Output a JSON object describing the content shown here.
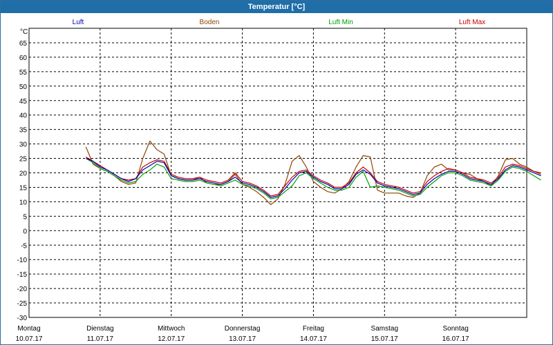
{
  "window": {
    "title": "Temperatur [°C]"
  },
  "chart_data": {
    "type": "line",
    "title": "Temperatur [°C]",
    "ylabel": "°C",
    "xlabel": "",
    "ylim": [
      -30,
      70
    ],
    "yticks": [
      65,
      60,
      55,
      50,
      45,
      40,
      35,
      30,
      25,
      20,
      15,
      10,
      5,
      0,
      -5,
      -10,
      -15,
      -20,
      -25,
      -30
    ],
    "grid": true,
    "legend_position": "top",
    "x_labels": [
      {
        "day": "Montag",
        "date": "10.07.17"
      },
      {
        "day": "Dienstag",
        "date": "11.07.17"
      },
      {
        "day": "Mittwoch",
        "date": "12.07.17"
      },
      {
        "day": "Donnerstag",
        "date": "13.07.17"
      },
      {
        "day": "Freitag",
        "date": "14.07.17"
      },
      {
        "day": "Samstag",
        "date": "15.07.17"
      },
      {
        "day": "Sonntag",
        "date": "16.07.17"
      }
    ],
    "x": [
      0.8,
      0.9,
      1,
      1.1,
      1.2,
      1.3,
      1.4,
      1.5,
      1.6,
      1.7,
      1.8,
      1.9,
      2,
      2.1,
      2.2,
      2.3,
      2.4,
      2.5,
      2.6,
      2.7,
      2.8,
      2.9,
      3,
      3.1,
      3.2,
      3.3,
      3.4,
      3.5,
      3.6,
      3.7,
      3.8,
      3.9,
      4,
      4.1,
      4.2,
      4.3,
      4.4,
      4.5,
      4.6,
      4.7,
      4.8,
      4.9,
      5,
      5.1,
      5.2,
      5.3,
      5.4,
      5.5,
      5.6,
      5.7,
      5.8,
      5.9,
      6,
      6.1,
      6.2,
      6.3,
      6.4,
      6.5,
      6.6,
      6.7,
      6.8,
      6.9,
      7,
      7.1,
      7.2,
      7.3,
      7.4,
      7.5,
      7.6,
      7.7,
      7.8,
      7.9,
      8,
      8.1,
      8.2,
      8.3,
      8.4,
      8.5,
      8.6
    ],
    "series": [
      {
        "name": "Luft",
        "color": "#0000b4",
        "values": [
          25,
          24,
          22,
          21,
          19.5,
          18,
          17,
          18,
          21,
          22.5,
          24,
          23.5,
          19,
          18,
          17.5,
          17.5,
          18,
          17,
          16.5,
          16,
          17,
          18.5,
          16.5,
          16,
          15,
          13.5,
          11.5,
          12,
          14.5,
          17.5,
          20,
          20.5,
          18.5,
          17,
          16,
          14.5,
          14.5,
          16,
          19.5,
          21,
          19.5,
          16.5,
          15.5,
          15,
          14.5,
          13.5,
          12.5,
          13,
          16,
          18,
          19.5,
          20.5,
          20.5,
          19.5,
          18,
          17.5,
          17,
          16,
          18,
          21,
          22.5,
          22,
          21,
          20,
          19
        ]
      },
      {
        "name": "Boden",
        "color": "#8b4500",
        "values": [
          29,
          23,
          21.5,
          20.5,
          19,
          17,
          16,
          16.5,
          25,
          31,
          28,
          26.5,
          19,
          18,
          17.5,
          17.5,
          18.5,
          16.5,
          16,
          16,
          17,
          19.5,
          16,
          15,
          13.5,
          11.5,
          9,
          11,
          16,
          24,
          26,
          22,
          17,
          15,
          13.5,
          13,
          14.5,
          17,
          22,
          26,
          25.5,
          14,
          13,
          13,
          13,
          12,
          11.5,
          13,
          19,
          22,
          23,
          21,
          21,
          20,
          19.5,
          18,
          17,
          15.5,
          19,
          24.5,
          25,
          23,
          22,
          20.5,
          19.5
        ]
      },
      {
        "name": "Luft Min",
        "color": "#00a000",
        "values": [
          25,
          23.5,
          21.5,
          20.5,
          19,
          17.5,
          16.5,
          17,
          19.5,
          21,
          23,
          22,
          18,
          17.5,
          17,
          17,
          17.5,
          16.5,
          16,
          15.5,
          16.5,
          17.5,
          16,
          15.5,
          14.5,
          13,
          11,
          11.5,
          13.5,
          15.5,
          19,
          20,
          18,
          16.5,
          15,
          14,
          14,
          15,
          18.5,
          20.5,
          15,
          15.5,
          15,
          14.5,
          14,
          13,
          12,
          12.5,
          15,
          17,
          19,
          20,
          20,
          19,
          17.5,
          17,
          16.5,
          15.5,
          17.5,
          20.5,
          22,
          21.5,
          20.5,
          19,
          17.5
        ]
      },
      {
        "name": "Luft Max",
        "color": "#c80000",
        "values": [
          25.5,
          24,
          22.5,
          21,
          19.5,
          18,
          17.5,
          18,
          22,
          23.5,
          24.5,
          24,
          19.5,
          18.5,
          18,
          18,
          18.5,
          17.5,
          17,
          16.5,
          17.5,
          20,
          17,
          16.5,
          15.5,
          14,
          12,
          12.5,
          15.5,
          18.5,
          20.5,
          21,
          19,
          17.5,
          16.5,
          15,
          15,
          16.5,
          20,
          22,
          20,
          17,
          16,
          15.5,
          15,
          14,
          13,
          13.5,
          17,
          19,
          20.5,
          21.5,
          21,
          20,
          18.5,
          18,
          17.5,
          16.5,
          18.5,
          22,
          23,
          22.5,
          21.5,
          20.5,
          20
        ]
      }
    ]
  }
}
